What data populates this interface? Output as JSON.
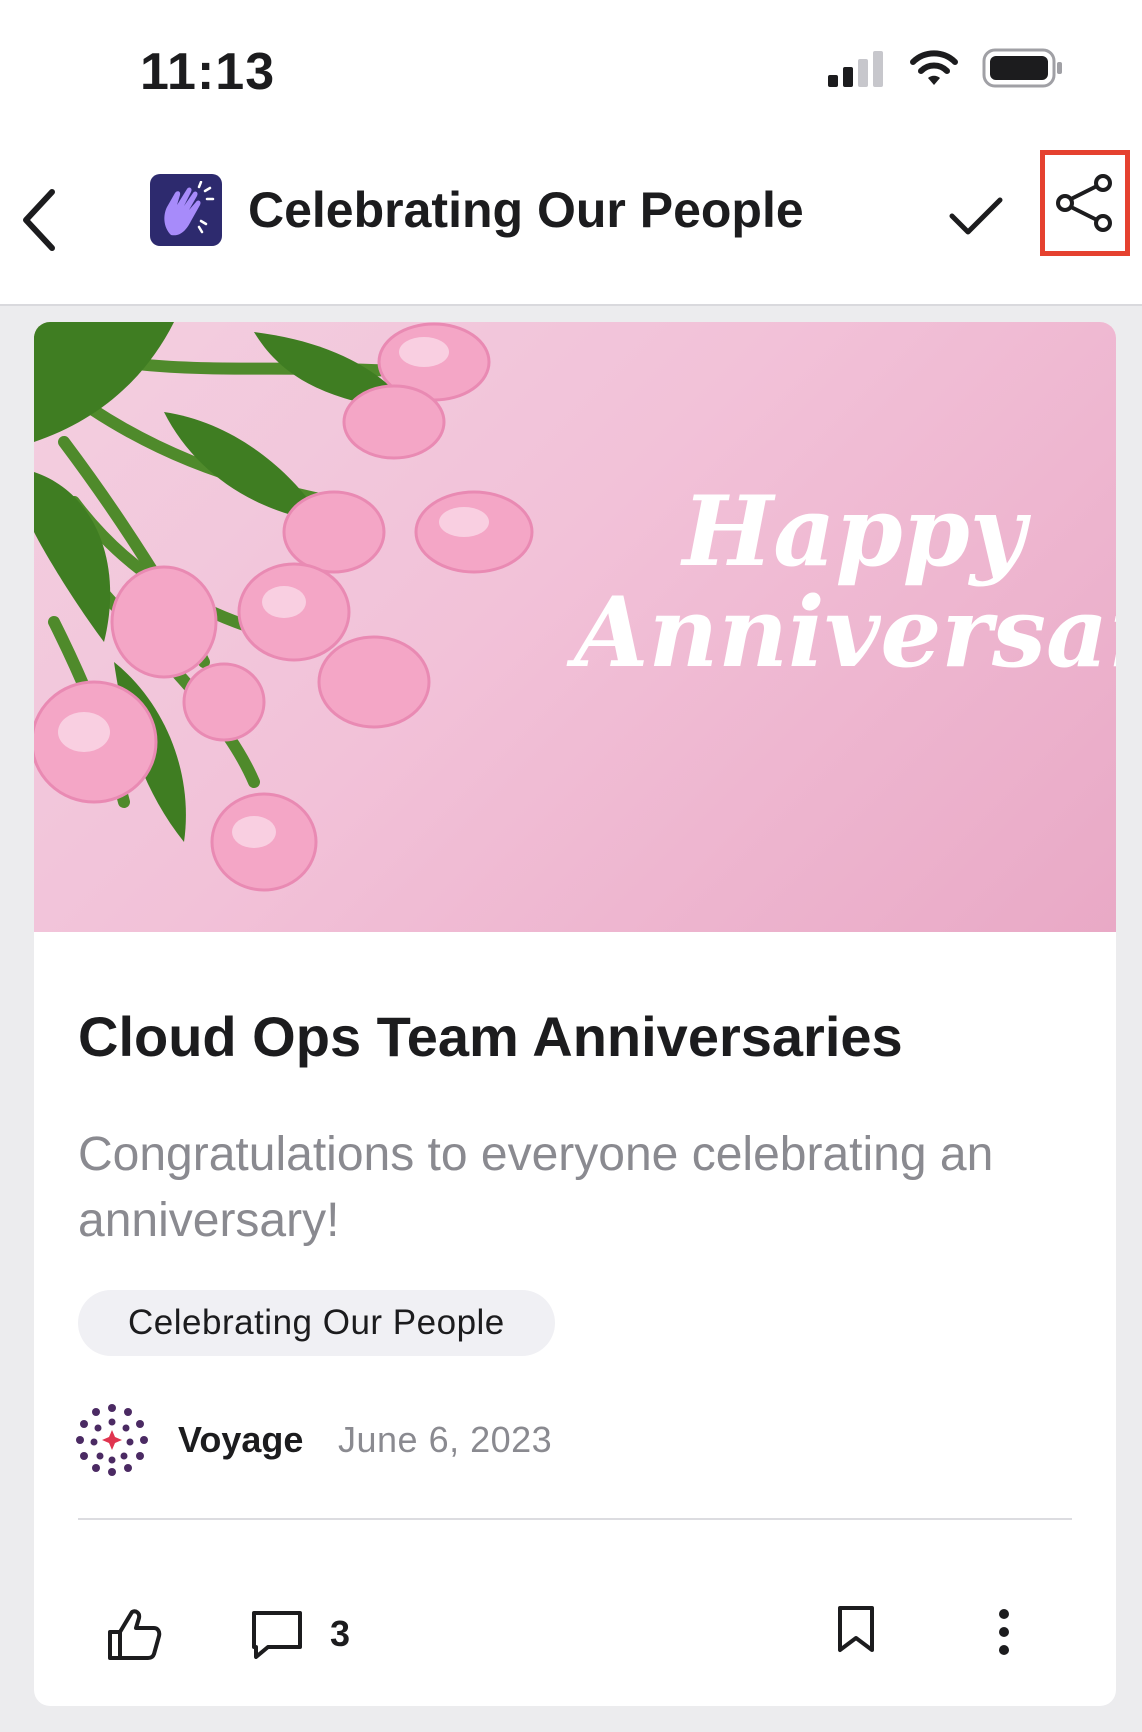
{
  "status_bar": {
    "time": "11:13",
    "icons": [
      "cellular-signal-icon",
      "wifi-icon",
      "battery-icon"
    ]
  },
  "nav": {
    "title": "Celebrating Our People",
    "icons": {
      "back": "chevron-left-icon",
      "channel": "clapping-hands-icon",
      "check": "checkmark-icon",
      "share": "share-icon"
    },
    "highlight_color": "#e5412f"
  },
  "post": {
    "hero_text_line1": "Happy",
    "hero_text_line2": "Anniversary",
    "title": "Cloud Ops Team Anniversaries",
    "summary": "Congratulations to everyone celebrating an anniversary!",
    "tag": "Celebrating Our People",
    "author": "Voyage",
    "date": "June 6, 2023",
    "comment_count": "3",
    "icons": {
      "like": "thumbs-up-icon",
      "comment": "comment-icon",
      "bookmark": "bookmark-icon",
      "more": "more-vertical-icon",
      "author_logo": "voyage-logo"
    }
  }
}
